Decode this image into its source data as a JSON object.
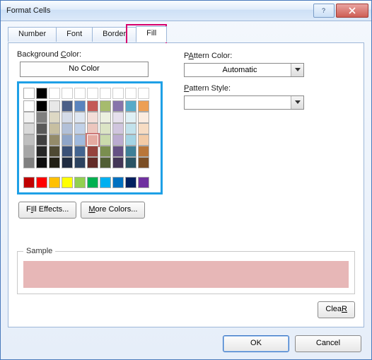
{
  "window": {
    "title": "Format Cells"
  },
  "tabs": {
    "number": "Number",
    "font": "Font",
    "border": "Border",
    "fill": "Fill",
    "active": "fill"
  },
  "fill": {
    "background_label": "Background Color:",
    "background_underline": "C",
    "no_color": "No Color",
    "fill_effects": "Fill Effects...",
    "fill_effects_underline": "I",
    "more_colors": "More Colors...",
    "more_colors_underline": "M",
    "pattern_color_label": "Pattern Color:",
    "pattern_color_underline": "A",
    "pattern_color_value": "Automatic",
    "pattern_style_label": "Pattern Style:",
    "pattern_style_underline": "P",
    "pattern_style_value": "",
    "sample_label": "Sample",
    "sample_color": "#e7b7b7",
    "clear": "Clear",
    "clear_underline": "R",
    "selected_swatch": "#e7b7b7",
    "palette_rows": [
      [
        "#ffffff",
        "#000000",
        "#e8e8e8",
        "#4b5f87",
        "#5a84be",
        "#c45a56",
        "#a6bb6d",
        "#8774ab",
        "#57aac8",
        "#ed9f54"
      ],
      [
        "#f2f2f2",
        "#7f7f7f",
        "#ddd8c4",
        "#d4dbe8",
        "#dfe7f2",
        "#f3ded9",
        "#ecf0e0",
        "#e6e0ed",
        "#dff0f5",
        "#fbece0"
      ],
      [
        "#d9d9d9",
        "#595959",
        "#c7bfa1",
        "#b2c0d8",
        "#c1d1e8",
        "#ecc6be",
        "#dbe4c5",
        "#d0c5de",
        "#c2e2ec",
        "#f7dcc3"
      ],
      [
        "#bfbfbf",
        "#404040",
        "#948b6a",
        "#8fa5c8",
        "#a0bade",
        "#e4aaa1",
        "#cadaac",
        "#bbabd0",
        "#a4d4e4",
        "#f3cba6"
      ],
      [
        "#a6a6a6",
        "#262626",
        "#4e4933",
        "#3b5177",
        "#436490",
        "#95423d",
        "#7a8e4f",
        "#655184",
        "#3e7f97",
        "#b97639"
      ],
      [
        "#808080",
        "#0d0d0d",
        "#222015",
        "#1f2b40",
        "#2c425f",
        "#622a26",
        "#515e34",
        "#433657",
        "#295364",
        "#7b4e25"
      ]
    ],
    "standard_row": [
      "#c00000",
      "#ff0000",
      "#ffc000",
      "#ffff00",
      "#92d050",
      "#00b050",
      "#00b0f0",
      "#0070c0",
      "#002060",
      "#7030a0"
    ]
  },
  "footer": {
    "ok": "OK",
    "cancel": "Cancel"
  },
  "icons": {
    "help": "?",
    "close": "✕"
  }
}
